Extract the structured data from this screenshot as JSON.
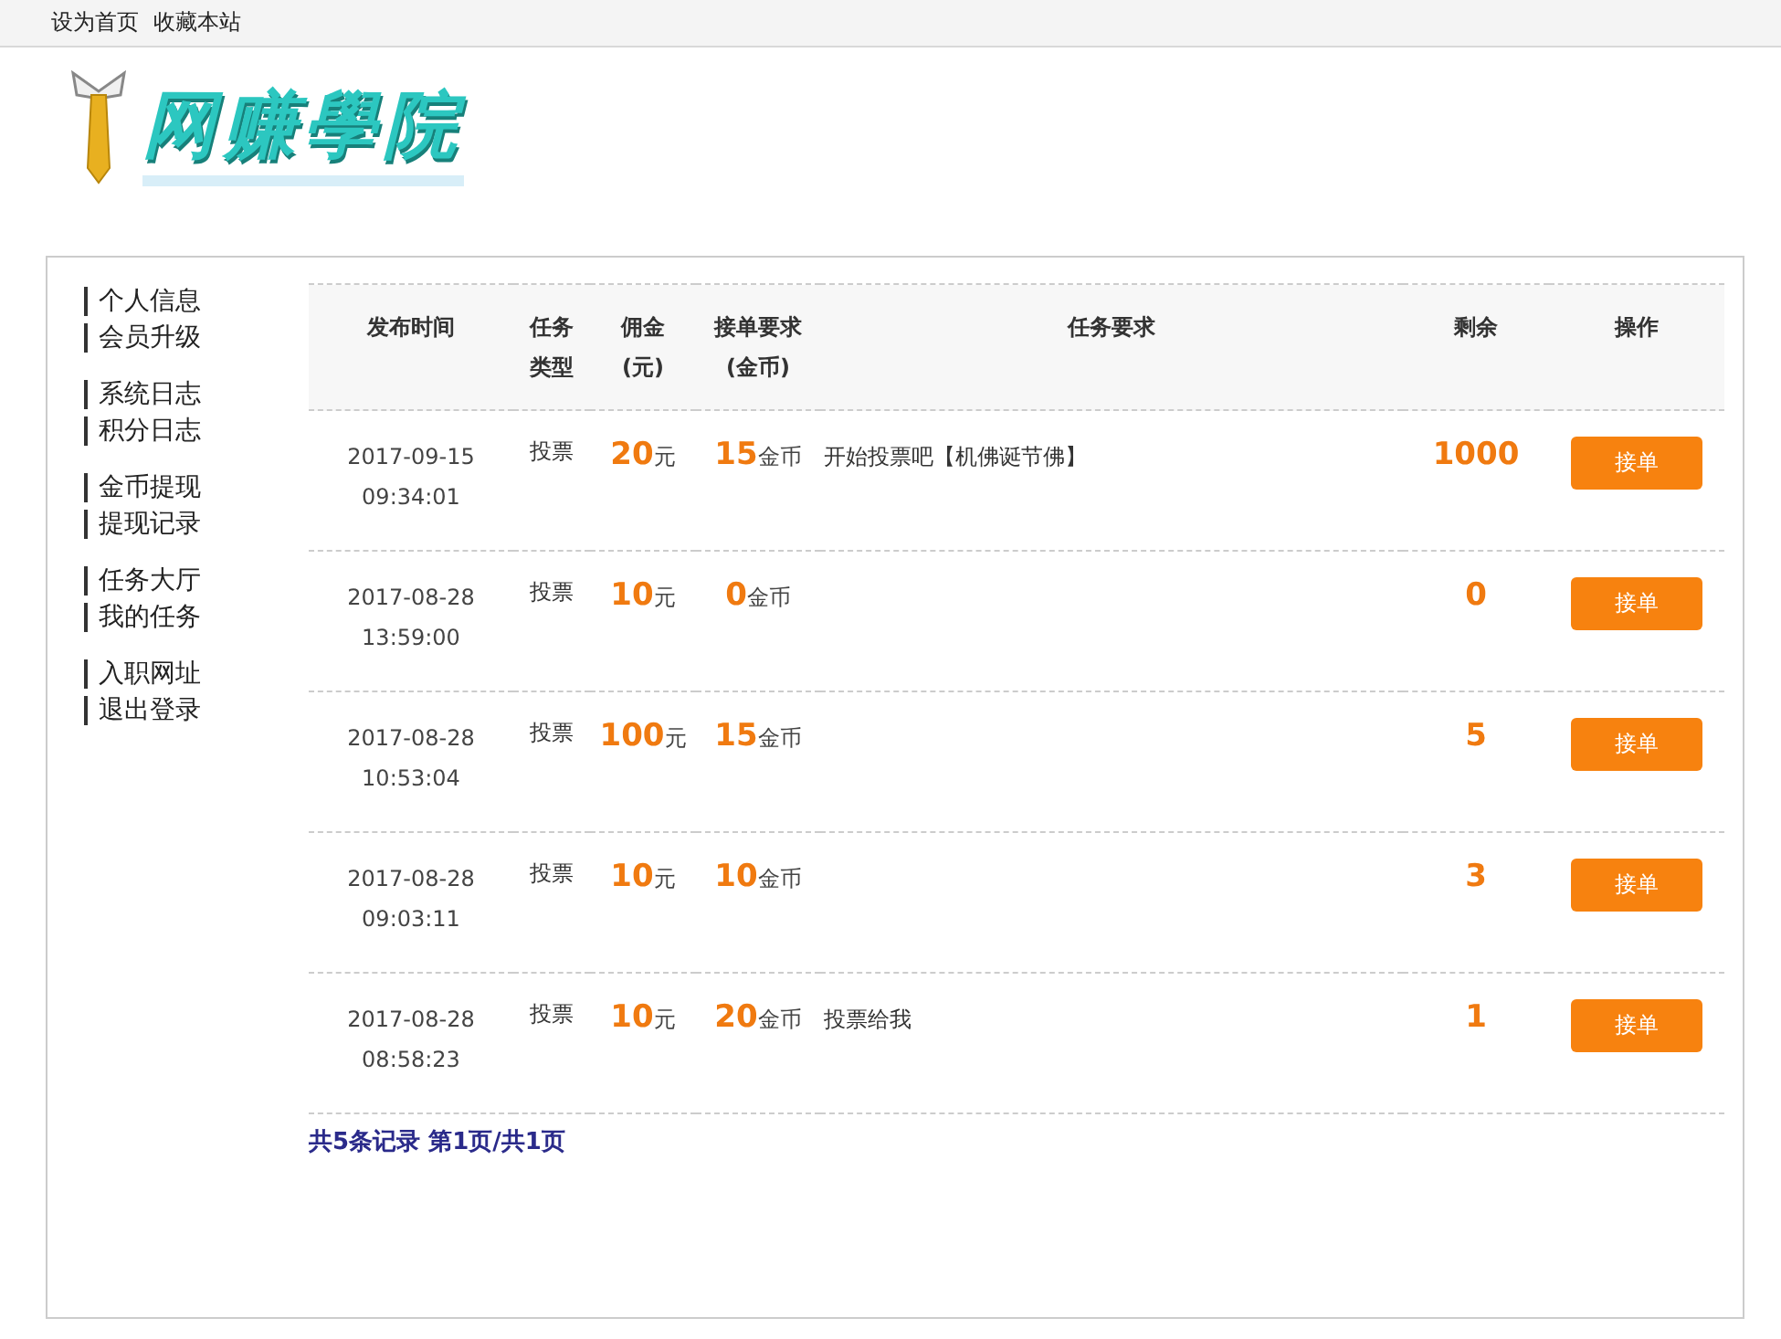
{
  "top_links": [
    "设为首页",
    "收藏本站"
  ],
  "logo": {
    "text": "网赚學院"
  },
  "sidebar": {
    "groups": [
      [
        "个人信息",
        "会员升级"
      ],
      [
        "系统日志",
        "积分日志"
      ],
      [
        "金币提现",
        "提现记录"
      ],
      [
        "任务大厅",
        "我的任务"
      ],
      [
        "入职网址",
        "退出登录"
      ]
    ]
  },
  "table": {
    "columns": [
      [
        "发布时间"
      ],
      [
        "任务",
        "类型"
      ],
      [
        "佣金",
        "(元)"
      ],
      [
        "接单要求",
        "(金币)"
      ],
      [
        "任务要求"
      ],
      [
        "剩余"
      ],
      [
        "操作"
      ]
    ],
    "rows": [
      {
        "date": "2017-09-15",
        "time": "09:34:01",
        "type": "投票",
        "commission": "20",
        "commission_unit": "元",
        "coins": "15",
        "coins_unit": "金币",
        "requirement": "开始投票吧【机佛诞节佛】",
        "remaining": "1000",
        "action": "接单"
      },
      {
        "date": "2017-08-28",
        "time": "13:59:00",
        "type": "投票",
        "commission": "10",
        "commission_unit": "元",
        "coins": "0",
        "coins_unit": "金币",
        "requirement": "",
        "remaining": "0",
        "action": "接单"
      },
      {
        "date": "2017-08-28",
        "time": "10:53:04",
        "type": "投票",
        "commission": "100",
        "commission_unit": "元",
        "coins": "15",
        "coins_unit": "金币",
        "requirement": "",
        "remaining": "5",
        "action": "接单"
      },
      {
        "date": "2017-08-28",
        "time": "09:03:11",
        "type": "投票",
        "commission": "10",
        "commission_unit": "元",
        "coins": "10",
        "coins_unit": "金币",
        "requirement": "",
        "remaining": "3",
        "action": "接单"
      },
      {
        "date": "2017-08-28",
        "time": "08:58:23",
        "type": "投票",
        "commission": "10",
        "commission_unit": "元",
        "coins": "20",
        "coins_unit": "金币",
        "requirement": "投票给我",
        "remaining": "1",
        "action": "接单"
      }
    ]
  },
  "pagination": "共5条记录 第1页/共1页"
}
